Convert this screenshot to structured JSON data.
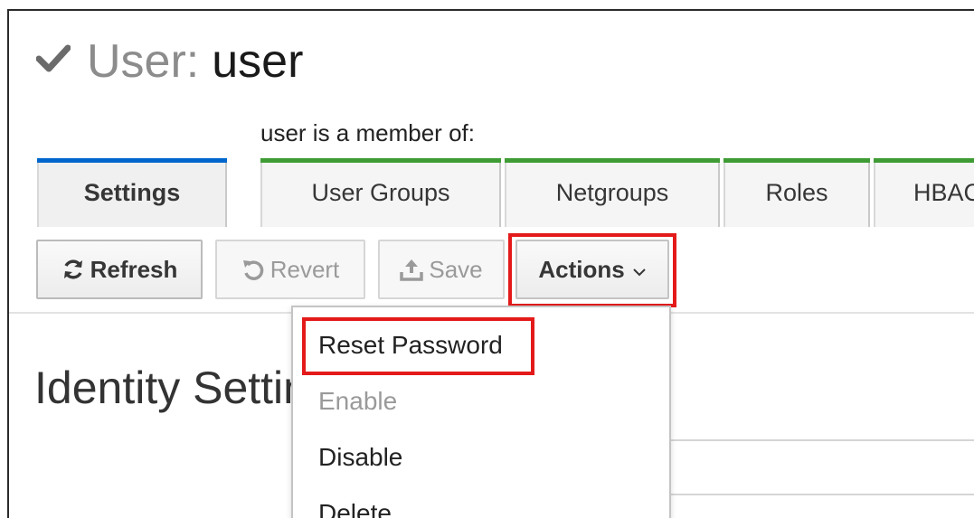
{
  "header": {
    "title_prefix": "User:",
    "title_name": "user",
    "member_label": "user is a member of:"
  },
  "tabs": [
    {
      "label": "Settings",
      "active": true
    },
    {
      "label": "User Groups"
    },
    {
      "label": "Netgroups"
    },
    {
      "label": "Roles"
    },
    {
      "label": "HBAC"
    }
  ],
  "toolbar": {
    "refresh_label": "Refresh",
    "revert_label": "Revert",
    "save_label": "Save",
    "actions_label": "Actions"
  },
  "section": {
    "title": "Identity Settings"
  },
  "actions_menu": {
    "items": [
      {
        "label": "Reset Password",
        "enabled": true
      },
      {
        "label": "Enable",
        "enabled": false
      },
      {
        "label": "Disable",
        "enabled": true
      },
      {
        "label": "Delete",
        "enabled": true
      }
    ]
  },
  "colors": {
    "active_tab_accent": "#0066cc",
    "group_tab_accent": "#3f9c35",
    "highlight": "#e41a1a"
  },
  "icons": [
    "check-icon",
    "refresh-icon",
    "undo-icon",
    "upload-icon",
    "chevron-down-icon"
  ]
}
